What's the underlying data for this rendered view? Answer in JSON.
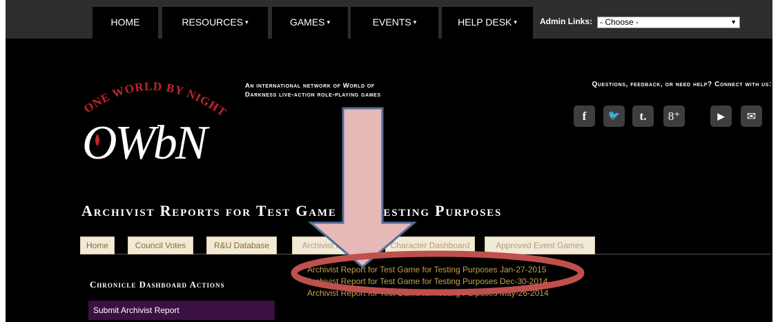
{
  "nav": {
    "items": [
      {
        "label": "HOME",
        "caret": ""
      },
      {
        "label": "RESOURCES",
        "caret": "▾"
      },
      {
        "label": "GAMES",
        "caret": "▾"
      },
      {
        "label": "EVENTS",
        "caret": "▾"
      },
      {
        "label": "HELP DESK",
        "caret": "▾"
      }
    ],
    "admin_label": "Admin Links:",
    "admin_select_value": "- Choose -"
  },
  "header": {
    "logo_arc_text": "ONE WORLD BY NIGHT",
    "logo_text": "OWbN",
    "tagline": "An international network of World of Darkness live-action role-playing games",
    "connect": "Questions, feedback, or need help? Connect with us:",
    "social": [
      {
        "icon": "facebook-icon",
        "glyph": "f"
      },
      {
        "icon": "twitter-icon",
        "glyph": "🐦"
      },
      {
        "icon": "tumblr-icon",
        "glyph": "t."
      },
      {
        "icon": "googleplus-icon",
        "glyph": "8⁺"
      },
      {
        "icon": "youtube-icon",
        "glyph": "▶"
      },
      {
        "icon": "mail-icon",
        "glyph": "✉"
      }
    ]
  },
  "page_title": "Archivist Reports for Test Game for Testing Purposes",
  "tabs": [
    "Home",
    "Council Votes",
    "R&U Database",
    "Archivist Reports",
    "Character Dashboard",
    "Approved Event Games"
  ],
  "dashboard": {
    "title": "Chronicle Dashboard Actions",
    "submit": "Submit Archivist Report"
  },
  "reports": [
    "Archivist Report for Test Game for Testing Purposes Jan-27-2015",
    "Archivist Report for Test Game for Testing Purposes Dec-30-2014",
    "Archivist Report for Test Game for Testing Purposes May-26-2014"
  ],
  "colors": {
    "nav_bg": "#2d2d2d",
    "tab_bg": "#f1ead6",
    "link": "#c8a050",
    "button_bg": "#3b1042",
    "logo_red": "#c0272d",
    "arrow_fill": "#e6b8b7",
    "arrow_stroke": "#4f6e9a",
    "ellipse_stroke": "#c0504d"
  }
}
